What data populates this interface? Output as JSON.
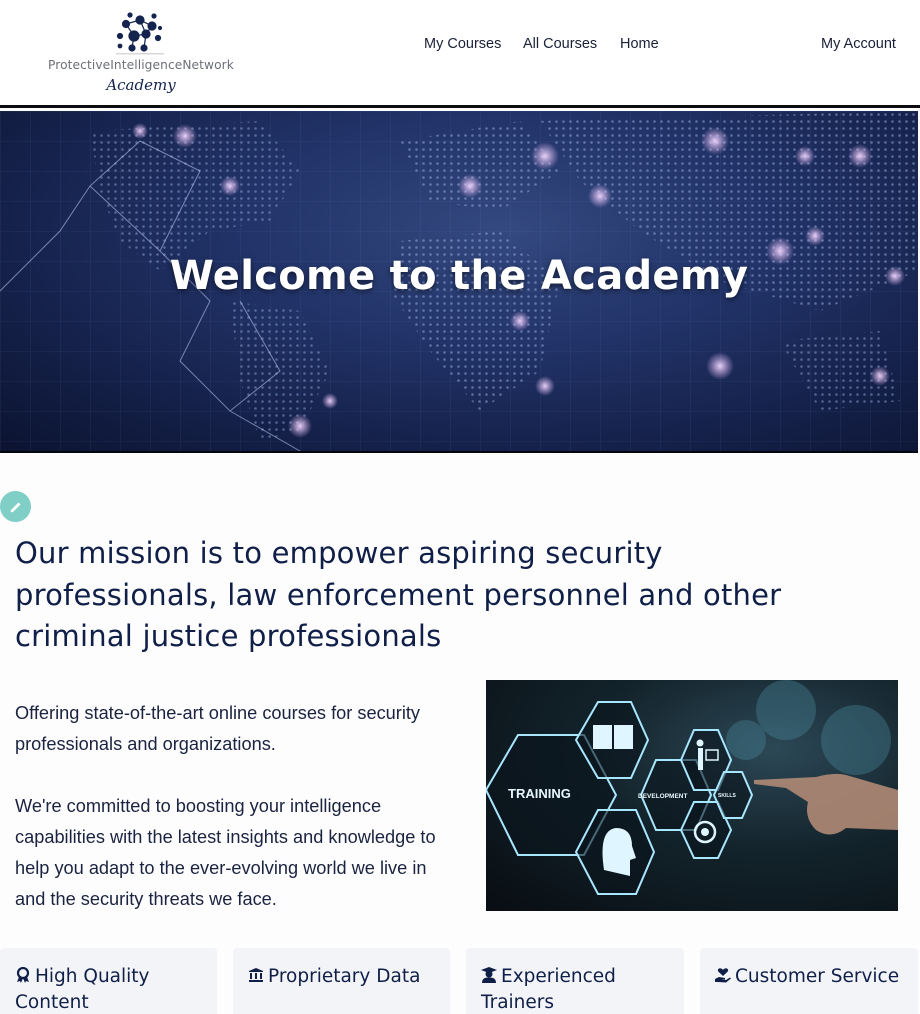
{
  "header": {
    "logo_text": "ProtectiveIntelligenceNetwork",
    "logo_subtitle": "Academy",
    "nav": [
      {
        "label": "My Courses"
      },
      {
        "label": "All Courses"
      },
      {
        "label": "Home"
      }
    ],
    "account_label": "My Account"
  },
  "hero": {
    "title": "Welcome to the Academy"
  },
  "edit_button": {
    "icon": "pencil-icon"
  },
  "mission": {
    "heading": "Our mission is to empower aspiring security professionals, law enforcement personnel and other criminal justice professionals"
  },
  "intro": {
    "paragraphs": [
      "Offering state-of-the-art online courses for security professionals and organizations.",
      "We're committed to boosting your intelligence capabilities with the latest insights and knowledge to help you adapt to the ever-evolving world we live in and the security threats we face."
    ]
  },
  "feature_image": {
    "labels": [
      "TRAINING",
      "DEVELOPMENT",
      "SKILLS"
    ]
  },
  "features": [
    {
      "icon": "award-icon",
      "title": "High Quality Content"
    },
    {
      "icon": "bank-icon",
      "title": "Proprietary Data"
    },
    {
      "icon": "graduate-icon",
      "title": "Experienced Trainers"
    },
    {
      "icon": "hand-heart-icon",
      "title": "Customer Service"
    }
  ],
  "colors": {
    "primary_text": "#0f1f48",
    "edit_fab": "#7fcfc6",
    "card_bg": "#f3f4f7"
  }
}
